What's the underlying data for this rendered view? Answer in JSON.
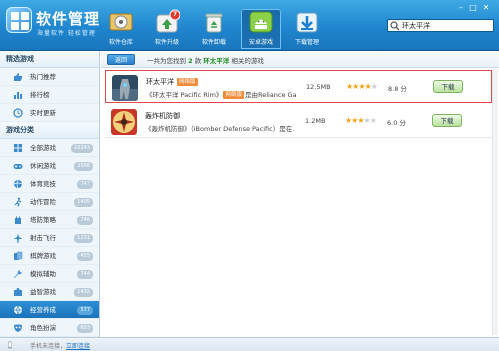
{
  "app": {
    "title": "软件管理",
    "slogan": "海量软件 轻松管理",
    "accent_color": "#1f86cf"
  },
  "toolbar": {
    "items": [
      {
        "label": "软件仓库",
        "icon": "software-repository-icon"
      },
      {
        "label": "软件升级",
        "icon": "software-upgrade-icon",
        "badge": "7"
      },
      {
        "label": "软件卸载",
        "icon": "recycle-bin-icon"
      },
      {
        "label": "安卓游戏",
        "icon": "android-games-icon"
      },
      {
        "label": "下载管理",
        "icon": "download-manager-icon"
      }
    ],
    "active_index": 3
  },
  "search": {
    "value": "环太平洋",
    "placeholder": ""
  },
  "sidebar": {
    "sections": [
      {
        "title": "精选游戏",
        "items": [
          {
            "label": "热门推荐",
            "icon": "thumb-up-icon",
            "count": ""
          },
          {
            "label": "排行榜",
            "icon": "ranking-icon",
            "count": ""
          },
          {
            "label": "实时更新",
            "icon": "clock-icon",
            "count": ""
          }
        ]
      },
      {
        "title": "游戏分类",
        "items": [
          {
            "label": "全部游戏",
            "icon": "grid-icon",
            "count": "10243"
          },
          {
            "label": "休闲游戏",
            "icon": "controller-icon",
            "count": "2566"
          },
          {
            "label": "体育竞技",
            "icon": "ball-icon",
            "count": "747"
          },
          {
            "label": "动作冒险",
            "icon": "runner-icon",
            "count": "1405"
          },
          {
            "label": "塔防策略",
            "icon": "tower-icon",
            "count": "746"
          },
          {
            "label": "射击飞行",
            "icon": "plane-icon",
            "count": "1231"
          },
          {
            "label": "棋牌游戏",
            "icon": "cards-icon",
            "count": "455"
          },
          {
            "label": "模拟辅助",
            "icon": "wrench-icon",
            "count": "744"
          },
          {
            "label": "益智游戏",
            "icon": "puzzle-icon",
            "count": "1432"
          },
          {
            "label": "经营养成",
            "icon": "globe-icon",
            "count": "577"
          },
          {
            "label": "角色扮演",
            "icon": "mask-icon",
            "count": "603"
          }
        ]
      }
    ],
    "active_label": "经营养成"
  },
  "main": {
    "back_label": "返回",
    "result": {
      "prefix": "一共为您找到",
      "count": "2",
      "mid": "款",
      "keyword": "环太平洋",
      "suffix": "相关的游戏"
    },
    "apps": [
      {
        "name": "环太平洋",
        "tag": "网络版",
        "desc_prefix": "《环太平洋 Pacific Rim》",
        "desc_tag": "网络版",
        "desc_suffix": "是由Reliance Games开发...",
        "size": "12.5MB",
        "rating": 4,
        "score": "8.8 分",
        "download_label": "下载",
        "selected": true
      },
      {
        "name": "轰炸机防御",
        "tag": "",
        "desc_prefix": "《轰炸机防御》（iBomber Defense Pacific）是在...",
        "desc_tag": "",
        "desc_suffix": "",
        "size": "1.2MB",
        "rating": 3,
        "score": "6.0 分",
        "download_label": "下载",
        "selected": false
      }
    ]
  },
  "statusbar": {
    "text": "手机未连接，",
    "link": "立即连接"
  }
}
